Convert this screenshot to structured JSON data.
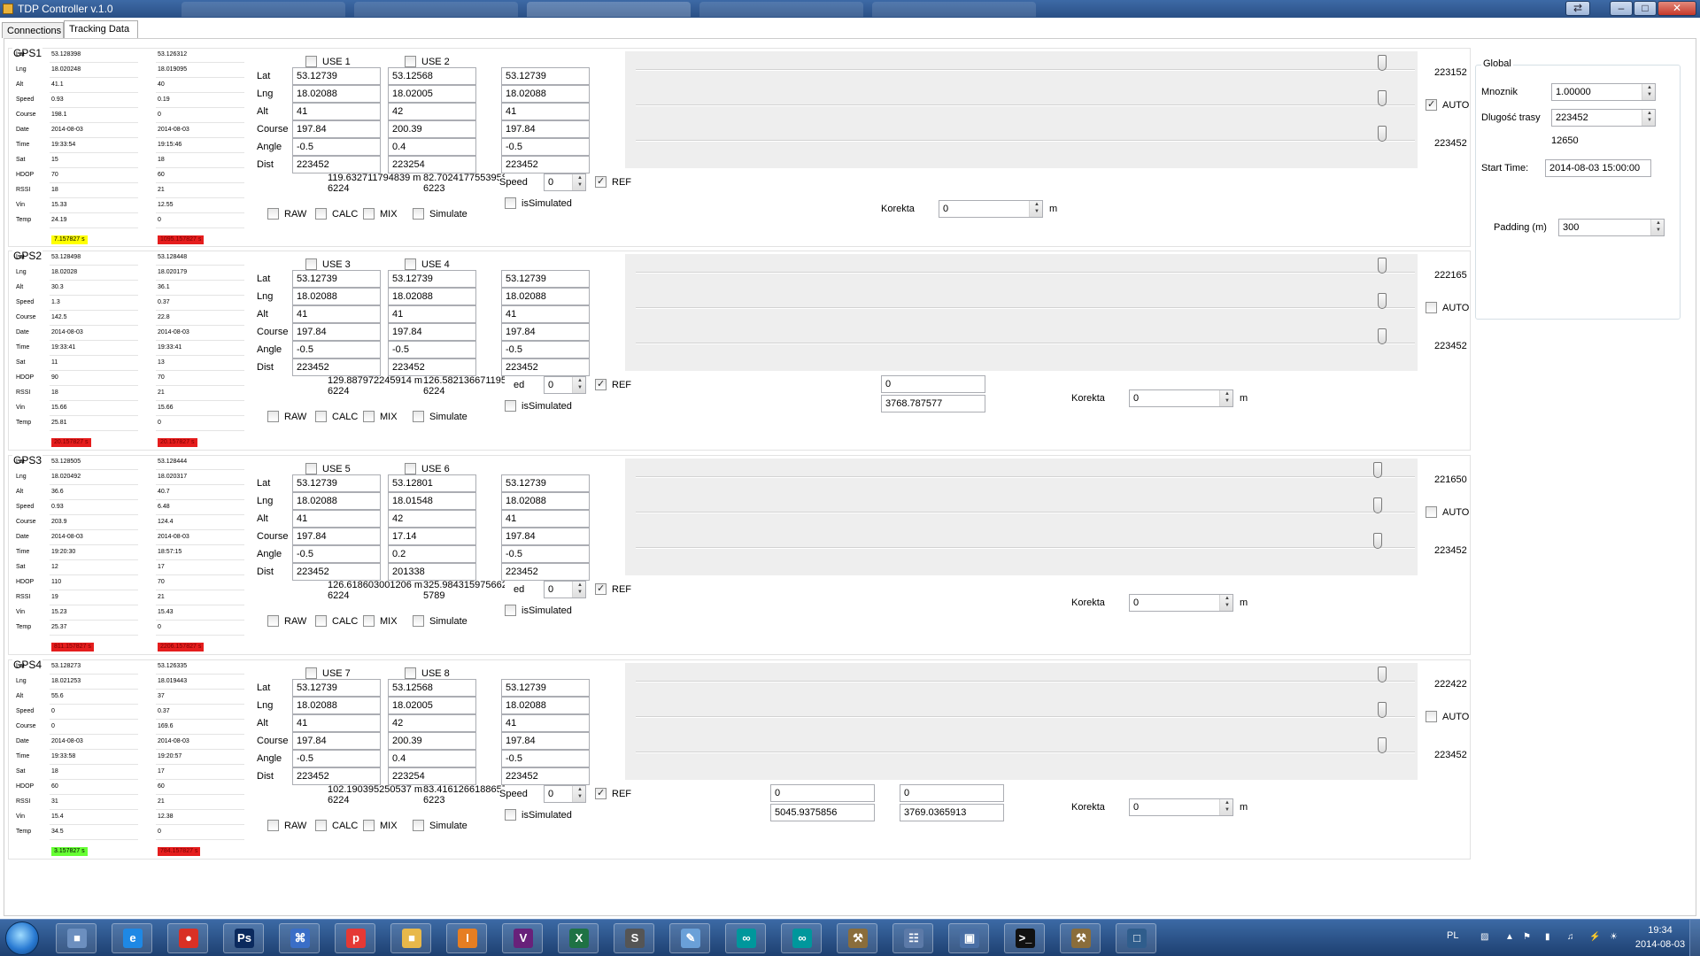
{
  "window": {
    "title": "TDP Controller v.1.0"
  },
  "tabs": [
    "Connections",
    "Tracking Data"
  ],
  "sensor_keys": [
    "Lat",
    "Lng",
    "Alt",
    "Speed",
    "Course",
    "Date",
    "Time",
    "Sat",
    "HDOP",
    "RSSI",
    "Vin",
    "Temp"
  ],
  "field_labels": [
    "Lat",
    "Lng",
    "Alt",
    "Course",
    "Angle",
    "Dist"
  ],
  "labels": {
    "raw": "RAW",
    "calc": "CALC",
    "mix": "MIX",
    "simulate": "Simulate",
    "speed": "Speed",
    "speed_clipped": "ed",
    "ref": "REF",
    "is_simulated": "isSimulated",
    "auto": "AUTO",
    "korekta": "Korekta",
    "m": "m"
  },
  "gps": [
    {
      "name": "GPS1",
      "sensor_a": [
        "53.128398",
        "18.020248",
        "41.1",
        "0.93",
        "198.1",
        "2014-08-03",
        "19:33:54",
        "15",
        "70",
        "18",
        "15.33",
        "24.19"
      ],
      "sensor_b": [
        "53.126312",
        "18.019095",
        "40",
        "0.19",
        "0",
        "2014-08-03",
        "19:15:46",
        "18",
        "60",
        "21",
        "12.55",
        "0"
      ],
      "badge_a": {
        "text": "7.157827 s",
        "color": "yellow"
      },
      "badge_b": {
        "text": "1095.157827 s",
        "color": "red"
      },
      "use": [
        "USE 1",
        "USE 2"
      ],
      "use_checked": [
        false,
        false
      ],
      "cols": [
        [
          "53.12739",
          "18.02088",
          "41",
          "197.84",
          "-0.5",
          "223452"
        ],
        [
          "53.12568",
          "18.02005",
          "42",
          "200.39",
          "0.4",
          "223254"
        ],
        [
          "53.12739",
          "18.02088",
          "41",
          "197.84",
          "-0.5",
          "223452"
        ]
      ],
      "dist_a": "119.632711794839 m",
      "count_a": "6224",
      "dist_b": "82.7024177553958 m",
      "count_b": "6223",
      "speed_value": "0",
      "ref_checked": true,
      "track_values": [
        "223152",
        "",
        "223452"
      ],
      "auto_checked": true,
      "korekta_value": "0",
      "extra_boxes": []
    },
    {
      "name": "GPS2",
      "sensor_a": [
        "53.128498",
        "18.02028",
        "30.3",
        "1.3",
        "142.5",
        "2014-08-03",
        "19:33:41",
        "11",
        "90",
        "18",
        "15.66",
        "25.81"
      ],
      "sensor_b": [
        "53.128448",
        "18.020179",
        "36.1",
        "0.37",
        "22.8",
        "2014-08-03",
        "19:33:41",
        "13",
        "70",
        "21",
        "15.66",
        "0"
      ],
      "badge_a": {
        "text": "20.157827 s",
        "color": "red"
      },
      "badge_b": {
        "text": "20.157827 s",
        "color": "red"
      },
      "use": [
        "USE 3",
        "USE 4"
      ],
      "use_checked": [
        false,
        false
      ],
      "cols": [
        [
          "53.12739",
          "18.02088",
          "41",
          "197.84",
          "-0.5",
          "223452"
        ],
        [
          "53.12739",
          "18.02088",
          "41",
          "197.84",
          "-0.5",
          "223452"
        ],
        [
          "53.12739",
          "18.02088",
          "41",
          "197.84",
          "-0.5",
          "223452"
        ]
      ],
      "dist_a": "129.887972245914 m",
      "count_a": "6224",
      "dist_b": "126.582136671195 m",
      "count_b": "6224",
      "speed_value": "0",
      "ref_checked": true,
      "track_values": [
        "222165",
        "",
        "223452"
      ],
      "auto_checked": false,
      "korekta_value": "0",
      "extra_boxes": [
        {
          "top": "0",
          "bottom": "3768.787577"
        }
      ]
    },
    {
      "name": "GPS3",
      "sensor_a": [
        "53.128505",
        "18.020492",
        "36.6",
        "0.93",
        "203.9",
        "2014-08-03",
        "19:20:30",
        "12",
        "110",
        "19",
        "15.23",
        "25.37"
      ],
      "sensor_b": [
        "53.128444",
        "18.020317",
        "40.7",
        "6.48",
        "124.4",
        "2014-08-03",
        "18:57:15",
        "17",
        "70",
        "21",
        "15.43",
        "0"
      ],
      "badge_a": {
        "text": "811.157827 s",
        "color": "red"
      },
      "badge_b": {
        "text": "2206.157827 s",
        "color": "red"
      },
      "use": [
        "USE 5",
        "USE 6"
      ],
      "use_checked": [
        false,
        false
      ],
      "cols": [
        [
          "53.12739",
          "18.02088",
          "41",
          "197.84",
          "-0.5",
          "223452"
        ],
        [
          "53.12801",
          "18.01548",
          "42",
          "17.14",
          "0.2",
          "201338"
        ],
        [
          "53.12739",
          "18.02088",
          "41",
          "197.84",
          "-0.5",
          "223452"
        ]
      ],
      "dist_a": "126.618603001206 m",
      "count_a": "6224",
      "dist_b": "325.984315975662 m",
      "count_b": "5789",
      "speed_value": "0",
      "ref_checked": true,
      "track_values": [
        "221650",
        "",
        "223452"
      ],
      "auto_checked": false,
      "korekta_value": "0",
      "extra_boxes": []
    },
    {
      "name": "GPS4",
      "sensor_a": [
        "53.128273",
        "18.021253",
        "55.6",
        "0",
        "0",
        "2014-08-03",
        "19:33:58",
        "18",
        "60",
        "31",
        "15.4",
        "34.5"
      ],
      "sensor_b": [
        "53.126335",
        "18.019443",
        "37",
        "0.37",
        "169.6",
        "2014-08-03",
        "19:20:57",
        "17",
        "60",
        "21",
        "12.38",
        "0"
      ],
      "badge_a": {
        "text": "3.157827 s",
        "color": "green"
      },
      "badge_b": {
        "text": "784.157827 s",
        "color": "red"
      },
      "use": [
        "USE 7",
        "USE 8"
      ],
      "use_checked": [
        false,
        false
      ],
      "cols": [
        [
          "53.12739",
          "18.02088",
          "41",
          "197.84",
          "-0.5",
          "223452"
        ],
        [
          "53.12568",
          "18.02005",
          "42",
          "200.39",
          "0.4",
          "223254"
        ],
        [
          "53.12739",
          "18.02088",
          "41",
          "197.84",
          "-0.5",
          "223452"
        ]
      ],
      "dist_a": "102.190395250537 m",
      "count_a": "6224",
      "dist_b": "83.4161266188657 m",
      "count_b": "6223",
      "speed_value": "0",
      "ref_checked": true,
      "track_values": [
        "222422",
        "",
        "223452"
      ],
      "auto_checked": false,
      "korekta_value": "0",
      "extra_boxes": [
        {
          "top": "0",
          "bottom": "5045.9375856"
        },
        {
          "top": "0",
          "bottom": "3769.0365913"
        }
      ]
    }
  ],
  "global": {
    "title": "Global",
    "mnoznik_label": "Mnoznik",
    "mnoznik_value": "1.00000",
    "trasa_label": "Dlugość trasy",
    "trasa_value": "223452",
    "trasa_under": "12650",
    "start_label": "Start Time:",
    "start_value": "2014-08-03 15:00:00"
  },
  "padding": {
    "label": "Padding (m)",
    "value": "300"
  },
  "taskbar": {
    "apps": [
      "explorer",
      "ie",
      "chrome",
      "photoshop",
      "network",
      "pinnacle",
      "folder",
      "tarsia",
      "visual-studio",
      "excel",
      "sublime",
      "notepad",
      "arduino",
      "arduino2",
      "tool",
      "calc",
      "remote",
      "cmd",
      "settings",
      "app"
    ],
    "lang": "PL",
    "time": "19:34",
    "date": "2014-08-03"
  }
}
